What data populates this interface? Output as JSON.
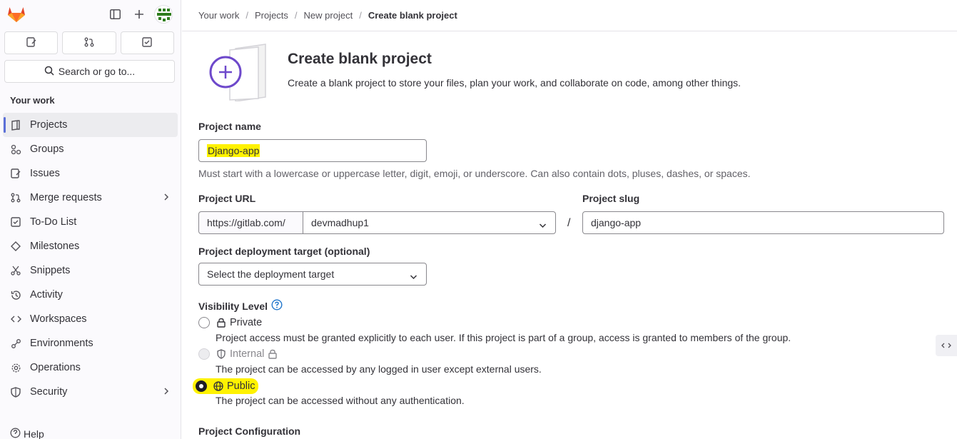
{
  "sidebar": {
    "section_title": "Your work",
    "search_label": "Search or go to...",
    "items": [
      {
        "label": "Projects"
      },
      {
        "label": "Groups"
      },
      {
        "label": "Issues"
      },
      {
        "label": "Merge requests"
      },
      {
        "label": "To-Do List"
      },
      {
        "label": "Milestones"
      },
      {
        "label": "Snippets"
      },
      {
        "label": "Activity"
      },
      {
        "label": "Workspaces"
      },
      {
        "label": "Environments"
      },
      {
        "label": "Operations"
      },
      {
        "label": "Security"
      }
    ],
    "help_label": "Help"
  },
  "breadcrumb": [
    "Your work",
    "Projects",
    "New project",
    "Create blank project"
  ],
  "hero": {
    "title": "Create blank project",
    "description": "Create a blank project to store your files, plan your work, and collaborate on code, among other things."
  },
  "form": {
    "name_label": "Project name",
    "name_value": "Django-app",
    "name_help": "Must start with a lowercase or uppercase letter, digit, emoji, or underscore. Can also contain dots, pluses, dashes, or spaces.",
    "url_label": "Project URL",
    "url_prefix": "https://gitlab.com/",
    "namespace_value": "devmadhup1",
    "slash": "/",
    "slug_label": "Project slug",
    "slug_value": "django-app",
    "deploy_label": "Project deployment target (optional)",
    "deploy_placeholder": "Select the deployment target",
    "visibility_label": "Visibility Level",
    "visibility": [
      {
        "label": "Private",
        "desc": "Project access must be granted explicitly to each user. If this project is part of a group, access is granted to members of the group."
      },
      {
        "label": "Internal",
        "desc": "The project can be accessed by any logged in user except external users."
      },
      {
        "label": "Public",
        "desc": "The project can be accessed without any authentication."
      }
    ],
    "config_label": "Project Configuration"
  },
  "colors": {
    "highlight": "#fff200",
    "accent": "#6e49cb",
    "link": "#1f75cb"
  }
}
